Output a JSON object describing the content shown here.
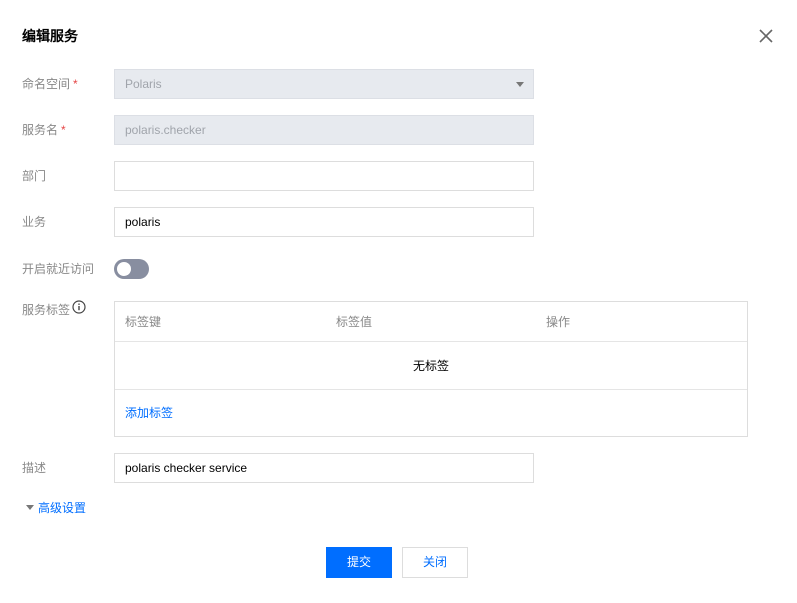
{
  "dialog": {
    "title": "编辑服务"
  },
  "form": {
    "namespace": {
      "label": "命名空间",
      "required_mark": "*",
      "value": "Polaris"
    },
    "service_name": {
      "label": "服务名",
      "required_mark": "*",
      "value": "polaris.checker"
    },
    "department": {
      "label": "部门",
      "value": ""
    },
    "business": {
      "label": "业务",
      "value": "polaris"
    },
    "nearby_access": {
      "label": "开启就近访问",
      "enabled": false
    },
    "service_tags": {
      "label": "服务标签",
      "columns": [
        "标签键",
        "标签值",
        "操作"
      ],
      "empty_text": "无标签",
      "add_label": "添加标签"
    },
    "description": {
      "label": "描述",
      "value": "polaris checker service"
    },
    "advanced_label": "高级设置"
  },
  "footer": {
    "submit_label": "提交",
    "close_label": "关闭"
  },
  "colors": {
    "primary": "#006eff",
    "required": "#e54545",
    "switch_off": "#888ea0"
  }
}
